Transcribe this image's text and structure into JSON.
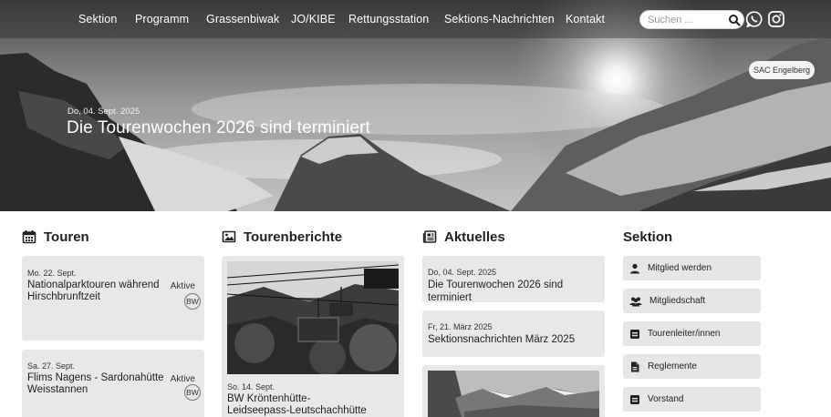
{
  "nav": {
    "items": [
      "Sektion",
      "Programm",
      "Grassenbiwak",
      "JO/KIBE",
      "Rettungsstation",
      "Sektions-Nachrichten",
      "Kontakt"
    ],
    "search_placeholder": "Suchen ...",
    "icons": [
      "search-icon",
      "whatsapp-icon",
      "instagram-icon"
    ]
  },
  "hero": {
    "logo_alt": "SAC Engelberg",
    "date": "Do, 04. Sept. 2025",
    "title": "Die Tourenwochen 2026 sind terminiert"
  },
  "touren": {
    "heading": "Touren",
    "icon": "calendar-icon",
    "items": [
      {
        "date": "Mo. 22. Sept.",
        "title_line1": "Nationalparktouren während",
        "title_line2": "Hirschbrunftzeit",
        "category": "Aktive",
        "badge": "BW"
      },
      {
        "date": "Sa. 27. Sept.",
        "title_line1": "Flims Nagens - Sardonahütte",
        "title_line2": "Weisstannen",
        "category": "Aktive",
        "badge": "BW"
      }
    ]
  },
  "tourenberichte": {
    "heading": "Tourenberichte",
    "icon": "image-icon",
    "items": [
      {
        "date": "So. 14. Sept.",
        "title_line1": "BW Kröntenhütte-",
        "title_line2": "Leidseepass-Leutschachhütte"
      }
    ]
  },
  "aktuelles": {
    "heading": "Aktuelles",
    "icon": "newspaper-icon",
    "items": [
      {
        "date": "Do, 04. Sept. 2025",
        "title": "Die Tourenwochen 2026 sind terminiert"
      },
      {
        "date": "Fr, 21. März 2025",
        "title": "Sektionsnachrichten März 2025"
      }
    ]
  },
  "sektion": {
    "heading": "Sektion",
    "buttons": [
      {
        "label": "Mitglied werden",
        "icon": "user-icon"
      },
      {
        "label": "Mitgliedschaft",
        "icon": "users-icon"
      },
      {
        "label": "Tourenleiter/innen",
        "icon": "badge-icon"
      },
      {
        "label": "Reglemente",
        "icon": "document-icon"
      },
      {
        "label": "Vorstand",
        "icon": "badge-icon"
      }
    ]
  }
}
